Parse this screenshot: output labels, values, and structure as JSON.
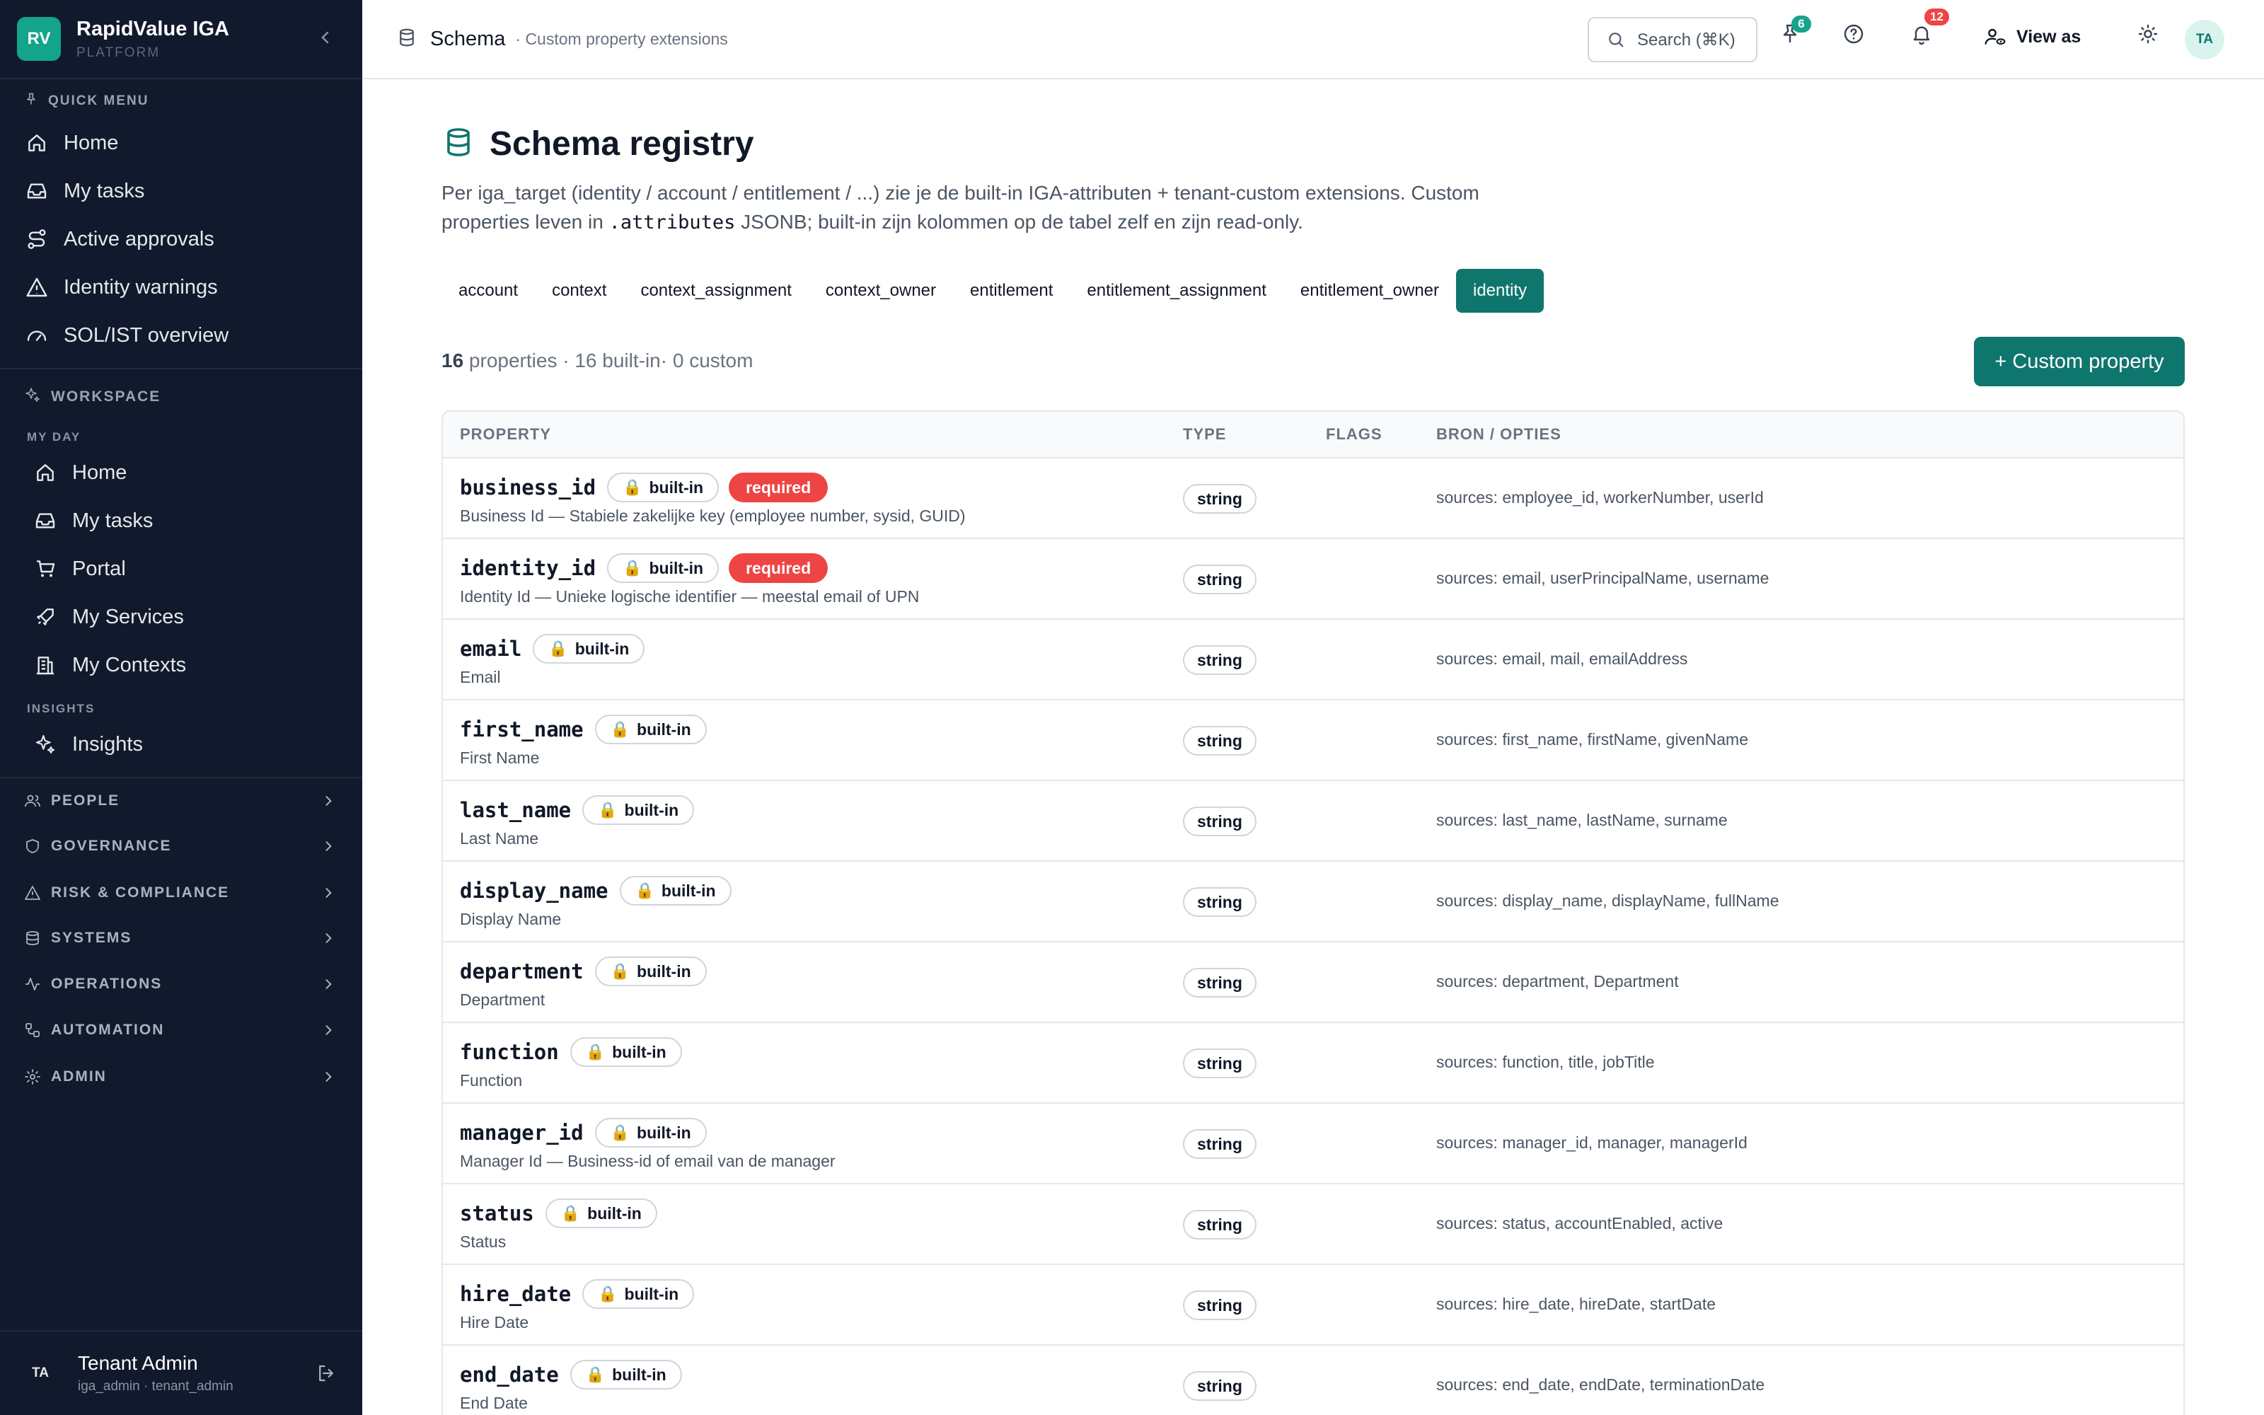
{
  "brand": {
    "logo": "RV",
    "name": "RapidValue IGA",
    "subtitle": "PLATFORM"
  },
  "sidebar": {
    "quick_menu": {
      "heading": "QUICK MENU",
      "items": [
        {
          "label": "Home",
          "icon": "home-icon"
        },
        {
          "label": "My tasks",
          "icon": "inbox-icon"
        },
        {
          "label": "Active approvals",
          "icon": "route-icon"
        },
        {
          "label": "Identity warnings",
          "icon": "warning-icon"
        },
        {
          "label": "SOL/IST overview",
          "icon": "gauge-icon"
        }
      ]
    },
    "workspace": {
      "heading": "WORKSPACE",
      "my_day_label": "MY DAY",
      "my_day_items": [
        {
          "label": "Home",
          "icon": "home-icon"
        },
        {
          "label": "My tasks",
          "icon": "inbox-icon"
        },
        {
          "label": "Portal",
          "icon": "cart-icon"
        },
        {
          "label": "My Services",
          "icon": "rocket-icon"
        },
        {
          "label": "My Contexts",
          "icon": "building-icon"
        }
      ],
      "insights_label": "INSIGHTS",
      "insights_items": [
        {
          "label": "Insights",
          "icon": "sparkles-icon"
        }
      ]
    },
    "groups": [
      {
        "label": "PEOPLE",
        "icon": "people-icon"
      },
      {
        "label": "GOVERNANCE",
        "icon": "shield-icon"
      },
      {
        "label": "RISK & COMPLIANCE",
        "icon": "warning-icon"
      },
      {
        "label": "SYSTEMS",
        "icon": "database-icon"
      },
      {
        "label": "OPERATIONS",
        "icon": "activity-icon"
      },
      {
        "label": "AUTOMATION",
        "icon": "workflow-icon"
      },
      {
        "label": "ADMIN",
        "icon": "gear-icon"
      }
    ],
    "user": {
      "initials": "TA",
      "name": "Tenant Admin",
      "role": "iga_admin · tenant_admin"
    }
  },
  "topbar": {
    "breadcrumb_title": "Schema",
    "breadcrumb_sub": "· Custom property extensions",
    "search_label": "Search (⌘K)",
    "pinned_count": "6",
    "notification_count": "12",
    "view_as_label": "View as",
    "avatar_initials": "TA"
  },
  "colors": {
    "accent": "#0f766e",
    "sidebar_bg": "#111a2c",
    "required": "#ef4444",
    "pin_badge": "#14a38b",
    "notif_badge": "#ef4444"
  },
  "main": {
    "title": "Schema registry",
    "description_part1": "Per iga_target (identity / account / entitlement / ...) zie je de built-in IGA-attributen + tenant-custom extensions. Custom properties leven in ",
    "description_code": ".attributes",
    "description_part2": " JSONB; built-in zijn kolommen op de tabel zelf en zijn read-only.",
    "tabs": [
      "account",
      "context",
      "context_assignment",
      "context_owner",
      "entitlement",
      "entitlement_assignment",
      "entitlement_owner",
      "identity"
    ],
    "active_tab": "identity",
    "stats_count": "16",
    "stats_rest": " properties · 16 built-in· 0 custom",
    "add_button": "+ Custom property",
    "table_headers": {
      "property": "PROPERTY",
      "type": "TYPE",
      "flags": "FLAGS",
      "source": "BRON / OPTIES"
    },
    "builtin_label": "built-in",
    "required_label": "required",
    "rows": [
      {
        "name": "business_id",
        "label": "Business Id — Stabiele zakelijke key (employee number, sysid, GUID)",
        "type": "string",
        "required": true,
        "sources": "sources: employee_id, workerNumber, userId"
      },
      {
        "name": "identity_id",
        "label": "Identity Id — Unieke logische identifier — meestal email of UPN",
        "type": "string",
        "required": true,
        "sources": "sources: email, userPrincipalName, username"
      },
      {
        "name": "email",
        "label": "Email",
        "type": "string",
        "required": false,
        "sources": "sources: email, mail, emailAddress"
      },
      {
        "name": "first_name",
        "label": "First Name",
        "type": "string",
        "required": false,
        "sources": "sources: first_name, firstName, givenName"
      },
      {
        "name": "last_name",
        "label": "Last Name",
        "type": "string",
        "required": false,
        "sources": "sources: last_name, lastName, surname"
      },
      {
        "name": "display_name",
        "label": "Display Name",
        "type": "string",
        "required": false,
        "sources": "sources: display_name, displayName, fullName"
      },
      {
        "name": "department",
        "label": "Department",
        "type": "string",
        "required": false,
        "sources": "sources: department, Department"
      },
      {
        "name": "function",
        "label": "Function",
        "type": "string",
        "required": false,
        "sources": "sources: function, title, jobTitle"
      },
      {
        "name": "manager_id",
        "label": "Manager Id — Business-id of email van de manager",
        "type": "string",
        "required": false,
        "sources": "sources: manager_id, manager, managerId"
      },
      {
        "name": "status",
        "label": "Status",
        "type": "string",
        "required": false,
        "sources": "sources: status, accountEnabled, active"
      },
      {
        "name": "hire_date",
        "label": "Hire Date",
        "type": "string",
        "required": false,
        "sources": "sources: hire_date, hireDate, startDate"
      },
      {
        "name": "end_date",
        "label": "End Date",
        "type": "string",
        "required": false,
        "sources": "sources: end_date, endDate, terminationDate"
      }
    ]
  }
}
